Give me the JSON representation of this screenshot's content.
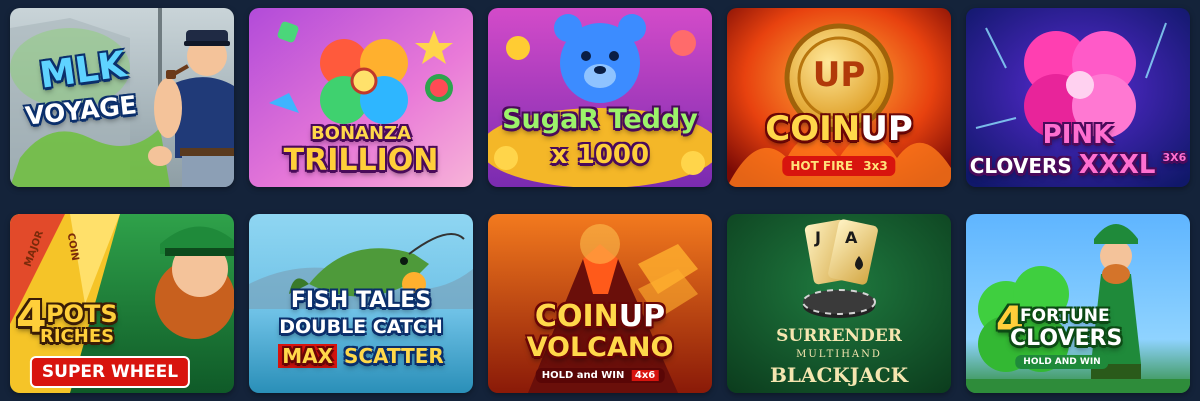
{
  "games": [
    {
      "id": "mlk",
      "title_line1": "MLK",
      "title_line2": "VOYAGE"
    },
    {
      "id": "bonanza",
      "title_line1": "BONANZA",
      "title_line2": "TRILLION"
    },
    {
      "id": "sugar",
      "title_line1": "SugaR Teddy",
      "title_line2": "x 1000"
    },
    {
      "id": "coinup",
      "title_line1": "COIN",
      "title_line2": "UP",
      "badge": "HOT FIRE",
      "badge_extra": "3x3",
      "coin_text": "UP"
    },
    {
      "id": "pink",
      "title_line1": "PINK",
      "title_line2": "CLOVERS",
      "title_line3": "XXXL",
      "badge": "3X6"
    },
    {
      "id": "pots",
      "title_line1": "4",
      "title_line2": "POTS",
      "title_line3": "RICHES",
      "badge": "SUPER WHEEL",
      "wheel_label1": "MAJOR",
      "wheel_label2": "COIN"
    },
    {
      "id": "fish",
      "title_line1": "FISH TALES",
      "title_line2": "DOUBLE CATCH",
      "title_line3": "MAX",
      "title_line4": "SCATTER"
    },
    {
      "id": "volcano",
      "title_line1": "COIN",
      "title_line2": "UP",
      "title_line3": "VOLCANO",
      "badge": "HOLD and WIN",
      "badge_extra": "4x6"
    },
    {
      "id": "blackjack",
      "title_line1": "SURRENDER",
      "title_line2": "MULTIHAND",
      "title_line3": "BLACKJACK",
      "card1": "J",
      "card2": "A"
    },
    {
      "id": "fortune",
      "title_line1": "4",
      "title_line2": "FORTUNE",
      "title_line3": "CLOVERS",
      "badge": "HOLD AND WIN"
    }
  ],
  "colors": {
    "page_background": "#14233a"
  }
}
